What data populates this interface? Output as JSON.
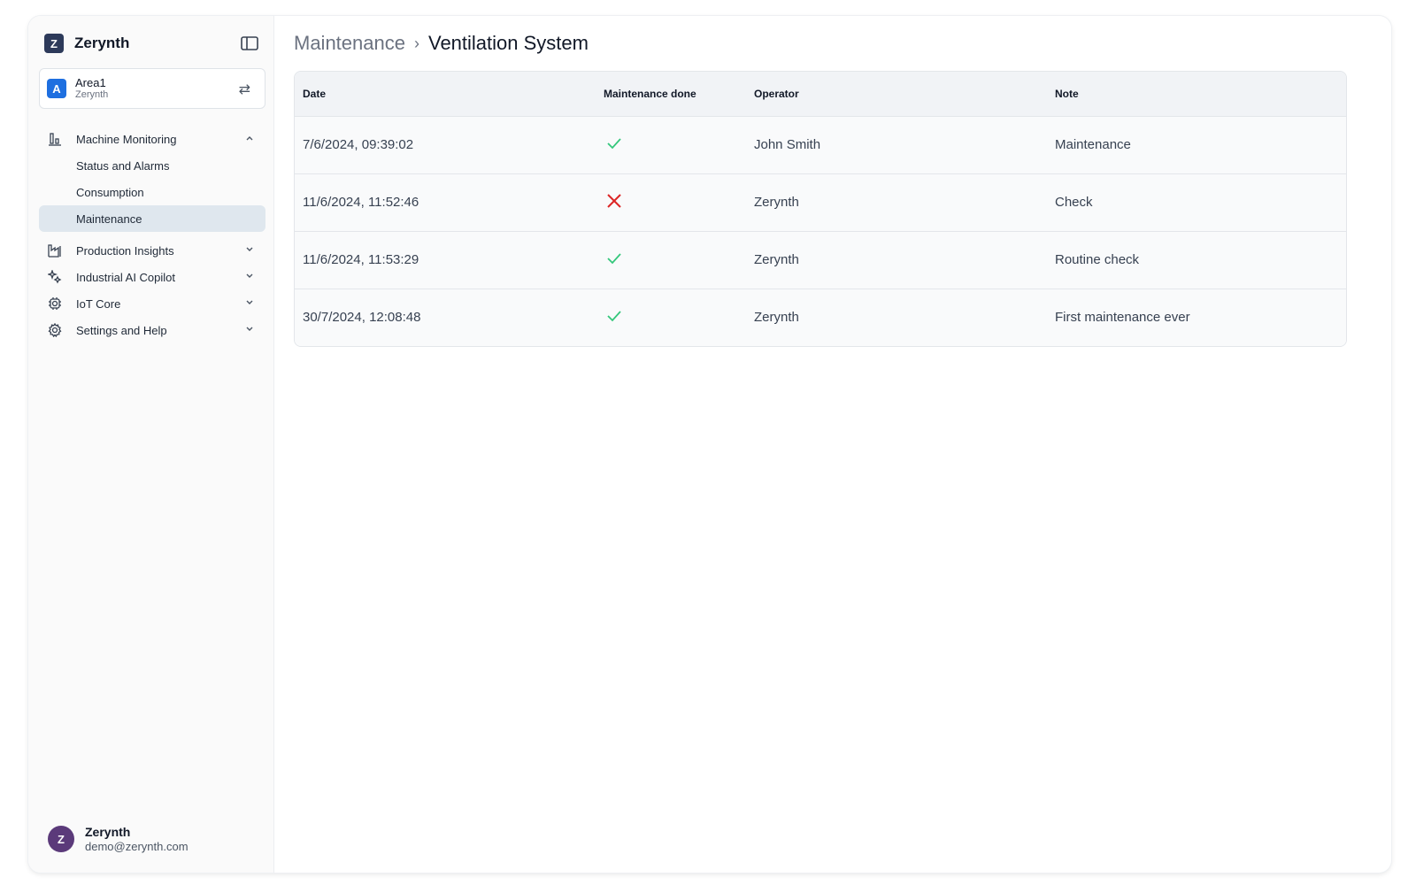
{
  "brand": {
    "logo_letter": "Z",
    "name": "Zerynth"
  },
  "area": {
    "badge": "A",
    "name": "Area1",
    "org": "Zerynth",
    "switch_icon": "swap-arrows-icon"
  },
  "sidebar": {
    "sections": [
      {
        "label": "Machine Monitoring",
        "icon": "bar-chart-icon",
        "expanded": true,
        "children": [
          {
            "label": "Status and Alarms",
            "active": false
          },
          {
            "label": "Consumption",
            "active": false
          },
          {
            "label": "Maintenance",
            "active": true
          }
        ]
      },
      {
        "label": "Production Insights",
        "icon": "factory-icon",
        "expanded": false
      },
      {
        "label": "Industrial AI Copilot",
        "icon": "sparkles-icon",
        "expanded": false
      },
      {
        "label": "IoT Core",
        "icon": "chip-icon",
        "expanded": false
      },
      {
        "label": "Settings and Help",
        "icon": "gear-icon",
        "expanded": false
      }
    ]
  },
  "user": {
    "initial": "Z",
    "name": "Zerynth",
    "email": "demo@zerynth.com"
  },
  "breadcrumb": {
    "parent": "Maintenance",
    "current": "Ventilation System"
  },
  "table": {
    "columns": [
      "Date",
      "Maintenance done",
      "Operator",
      "Note"
    ],
    "rows": [
      {
        "date": "7/6/2024, 09:39:02",
        "done": true,
        "operator": "John Smith",
        "note": "Maintenance"
      },
      {
        "date": "11/6/2024, 11:52:46",
        "done": false,
        "operator": "Zerynth",
        "note": "Check"
      },
      {
        "date": "11/6/2024, 11:53:29",
        "done": true,
        "operator": "Zerynth",
        "note": "Routine check"
      },
      {
        "date": "30/7/2024, 12:08:48",
        "done": true,
        "operator": "Zerynth",
        "note": "First maintenance ever"
      }
    ]
  },
  "colors": {
    "check": "#34c77b",
    "cross": "#dc2626",
    "active_bg": "#dfe7ee",
    "brand": "#2d3a5a",
    "area_badge": "#1e6fe0",
    "avatar": "#5b3a7a"
  }
}
